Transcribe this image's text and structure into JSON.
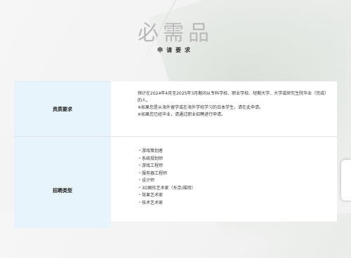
{
  "header": {
    "title": "必需品",
    "subtitle": "申请要求"
  },
  "requirements": {
    "label": "资质要求",
    "lines": [
      "预计在2024年4月至2025年3月期间从专科学校、职业学校、短期大学、大学或研究生院毕业（完成）的人。",
      "※如果您是从海外留学或在海外学校学习的日本学生，请在此申请。",
      "※如果您已经毕业，请通过职业招聘进行申请。"
    ]
  },
  "jobs": {
    "label": "招聘类型",
    "items": [
      "・游戏策划者",
      "・系统规划师",
      "・游戏工程师",
      "・服务器工程师",
      "・设计师",
      "・3D图形艺术家（东京/福冈）",
      "・效果艺术家",
      "・技术艺术家"
    ]
  }
}
